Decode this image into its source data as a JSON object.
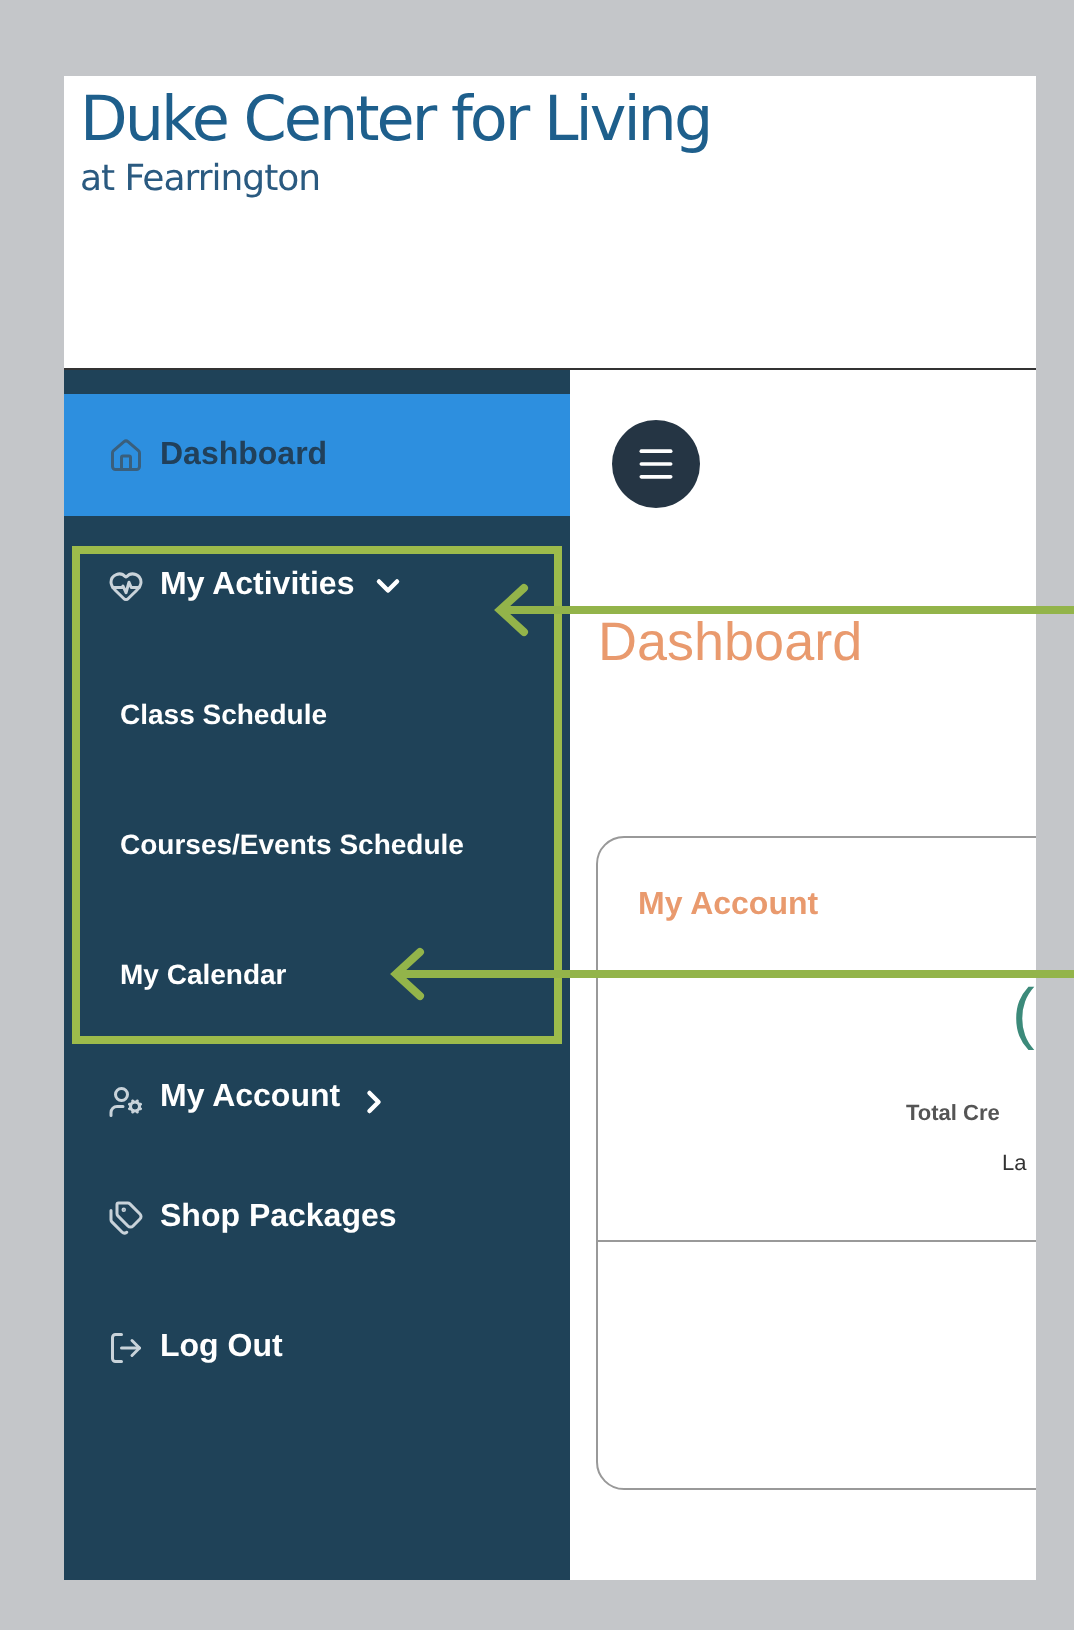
{
  "header": {
    "title": "Duke Center for Living",
    "subtitle": "at Fearrington"
  },
  "sidebar": {
    "items": [
      {
        "kind": "link",
        "label": "Dashboard",
        "selected": true
      },
      {
        "kind": "group",
        "label": "My Activities",
        "expanded": true,
        "highlighted": true,
        "annotated": true,
        "children": [
          {
            "label": "Class Schedule",
            "annotated": false
          },
          {
            "label": "Courses/Events Schedule",
            "annotated": false
          },
          {
            "label": "My Calendar",
            "annotated": true
          }
        ]
      },
      {
        "kind": "group",
        "label": "My Account",
        "expanded": false
      },
      {
        "kind": "link",
        "label": "Shop Packages",
        "selected": false
      },
      {
        "kind": "link",
        "label": "Log Out",
        "selected": false
      }
    ]
  },
  "main": {
    "heading": "Dashboard",
    "card": {
      "title": "My Account",
      "value": "(",
      "label": "Total Cre",
      "sublabel": "La"
    }
  }
}
